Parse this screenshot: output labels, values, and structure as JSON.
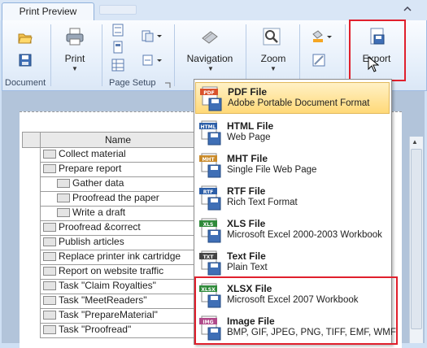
{
  "tabs": {
    "active": "Print Preview"
  },
  "ribbon": {
    "groups": {
      "document": "Document",
      "page_setup": "Page Setup"
    },
    "buttons": {
      "print": "Print",
      "navigation": "Navigation",
      "zoom": "Zoom",
      "export": "Export"
    }
  },
  "grid": {
    "header": "Name",
    "rows": [
      {
        "label": "Collect material",
        "indent": 0
      },
      {
        "label": "Prepare report",
        "indent": 0
      },
      {
        "label": "Gather data",
        "indent": 1
      },
      {
        "label": "Proofread the paper",
        "indent": 1
      },
      {
        "label": "Write a draft",
        "indent": 1
      },
      {
        "label": "Proofread &correct",
        "indent": 0
      },
      {
        "label": "Publish articles",
        "indent": 0
      },
      {
        "label": "Replace printer ink cartridge",
        "indent": 0
      },
      {
        "label": "Report on website traffic",
        "indent": 0
      },
      {
        "label": "Task \"Claim Royalties\"",
        "indent": 0
      },
      {
        "label": "Task \"MeetReaders\"",
        "indent": 0
      },
      {
        "label": "Task \"PrepareMaterial\"",
        "indent": 0
      },
      {
        "label": "Task \"Proofread\"",
        "indent": 0
      }
    ]
  },
  "export_menu": [
    {
      "badge": "PDF",
      "title": "PDF File",
      "desc": "Adobe Portable Document Format",
      "color": "#d9532c"
    },
    {
      "badge": "HTML",
      "title": "HTML File",
      "desc": "Web Page",
      "color": "#2d5fa8"
    },
    {
      "badge": "MHT",
      "title": "MHT File",
      "desc": "Single File Web Page",
      "color": "#c98a2a"
    },
    {
      "badge": "RTF",
      "title": "RTF File",
      "desc": "Rich Text Format",
      "color": "#2d5fa8"
    },
    {
      "badge": "XLS",
      "title": "XLS File",
      "desc": "Microsoft Excel 2000-2003 Workbook",
      "color": "#2f8a3a"
    },
    {
      "badge": "TXT",
      "title": "Text File",
      "desc": "Plain Text",
      "color": "#444444"
    },
    {
      "badge": "XLSX",
      "title": "XLSX File",
      "desc": "Microsoft Excel 2007 Workbook",
      "color": "#2f8a3a"
    },
    {
      "badge": "IMG",
      "title": "Image File",
      "desc": "BMP, GIF, JPEG, PNG, TIFF, EMF, WMF",
      "color": "#b04a8a"
    }
  ]
}
